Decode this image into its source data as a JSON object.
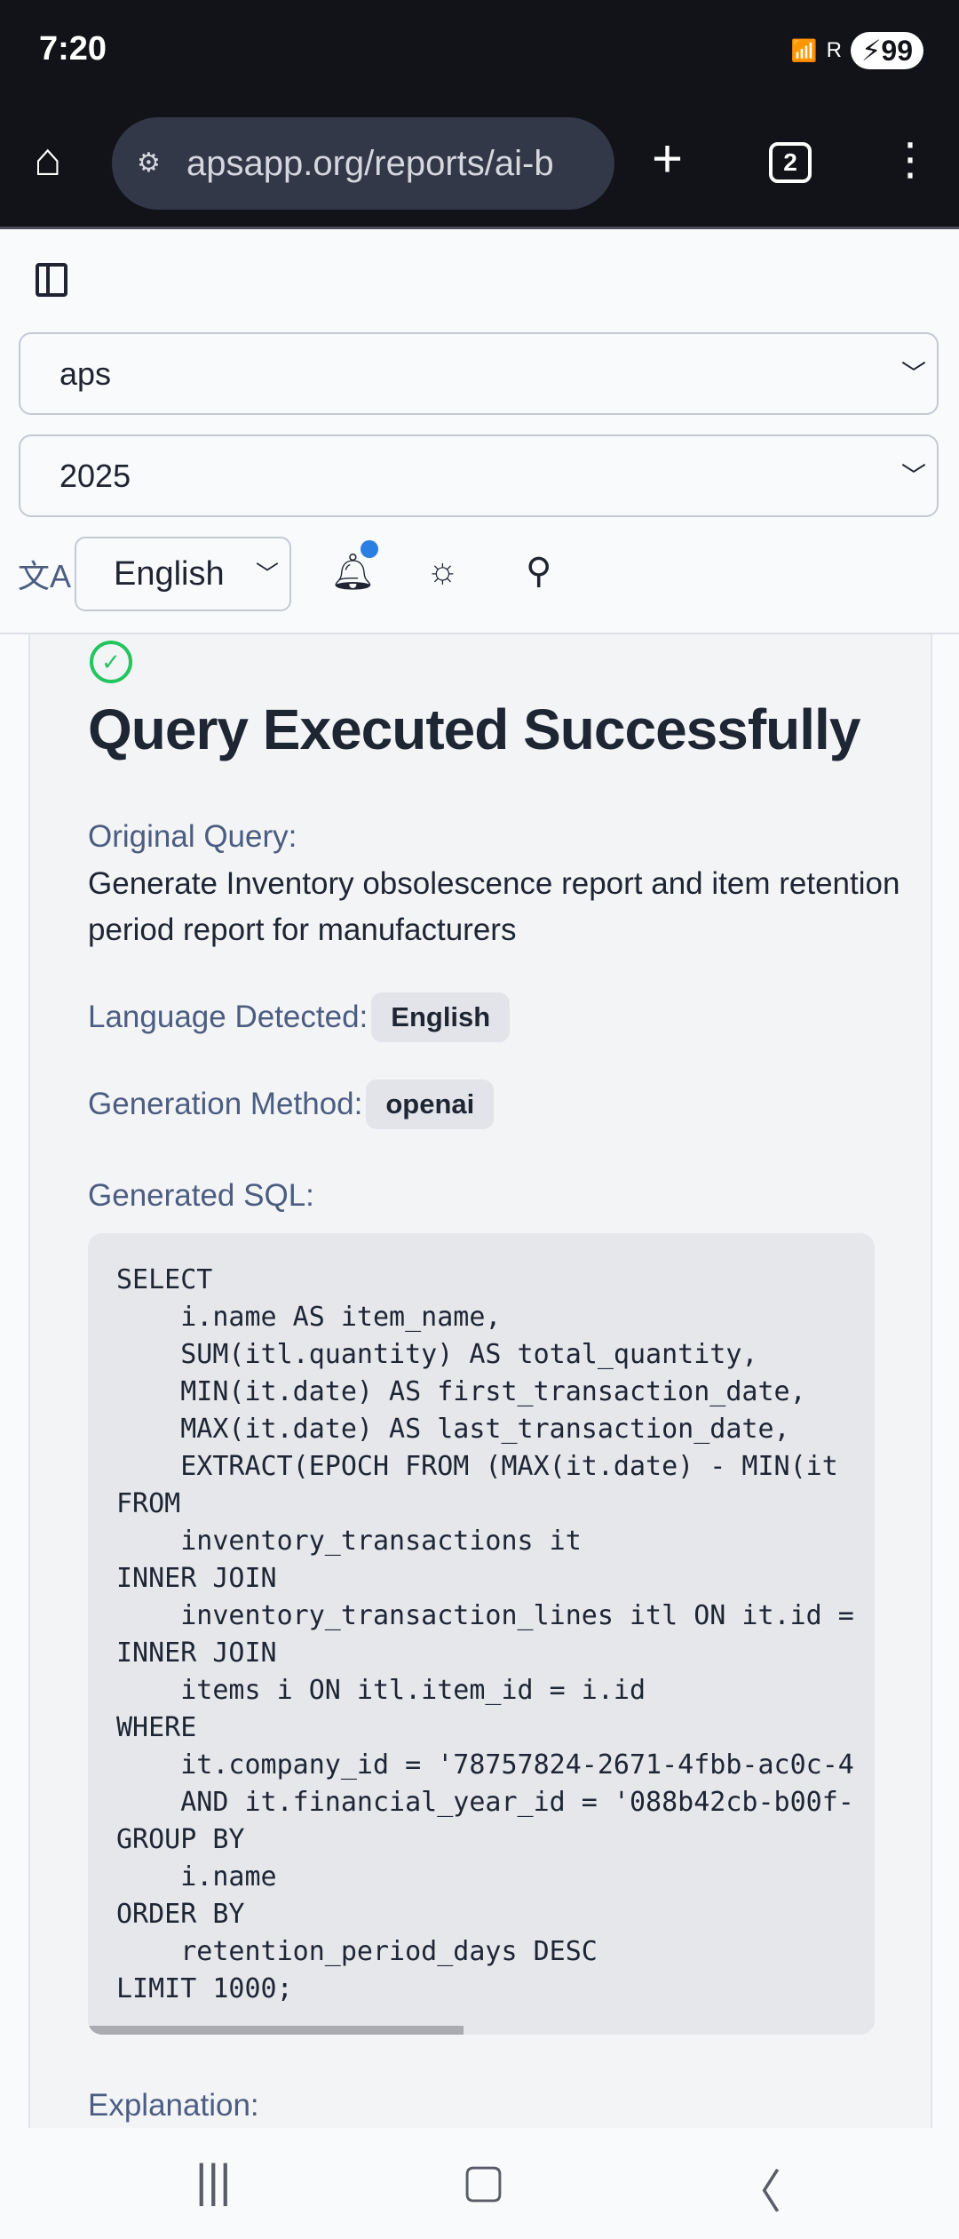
{
  "status_bar": {
    "time": "7:20",
    "battery": "99",
    "signal_label": "R"
  },
  "browser": {
    "url": "apsapp.org/reports/ai-b",
    "tab_count": "2"
  },
  "header": {
    "company_select": "aps",
    "year_select": "2025",
    "language_select": "English",
    "notification_dot_color": "#2b7fe0"
  },
  "result": {
    "title": "Query Executed Successfully",
    "original_query_label": "Original Query:",
    "original_query": "Generate Inventory obsolescence report and item retention period report for manufacturers",
    "language_label": "Language Detected:",
    "language_value": "English",
    "method_label": "Generation Method:",
    "method_value": "openai",
    "sql_label": "Generated SQL:",
    "sql": "SELECT\n    i.name AS item_name,\n    SUM(itl.quantity) AS total_quantity,\n    MIN(it.date) AS first_transaction_date,\n    MAX(it.date) AS last_transaction_date,\n    EXTRACT(EPOCH FROM (MAX(it.date) - MIN(it\nFROM\n    inventory_transactions it\nINNER JOIN\n    inventory_transaction_lines itl ON it.id =\nINNER JOIN\n    items i ON itl.item_id = i.id\nWHERE\n    it.company_id = '78757824-2671-4fbb-ac0c-4\n    AND it.financial_year_id = '088b42cb-b00f-\nGROUP BY\n    i.name\nORDER BY\n    retention_period_days DESC\nLIMIT 1000;",
    "explanation_label": "Explanation:",
    "success_color": "#22c55e"
  }
}
